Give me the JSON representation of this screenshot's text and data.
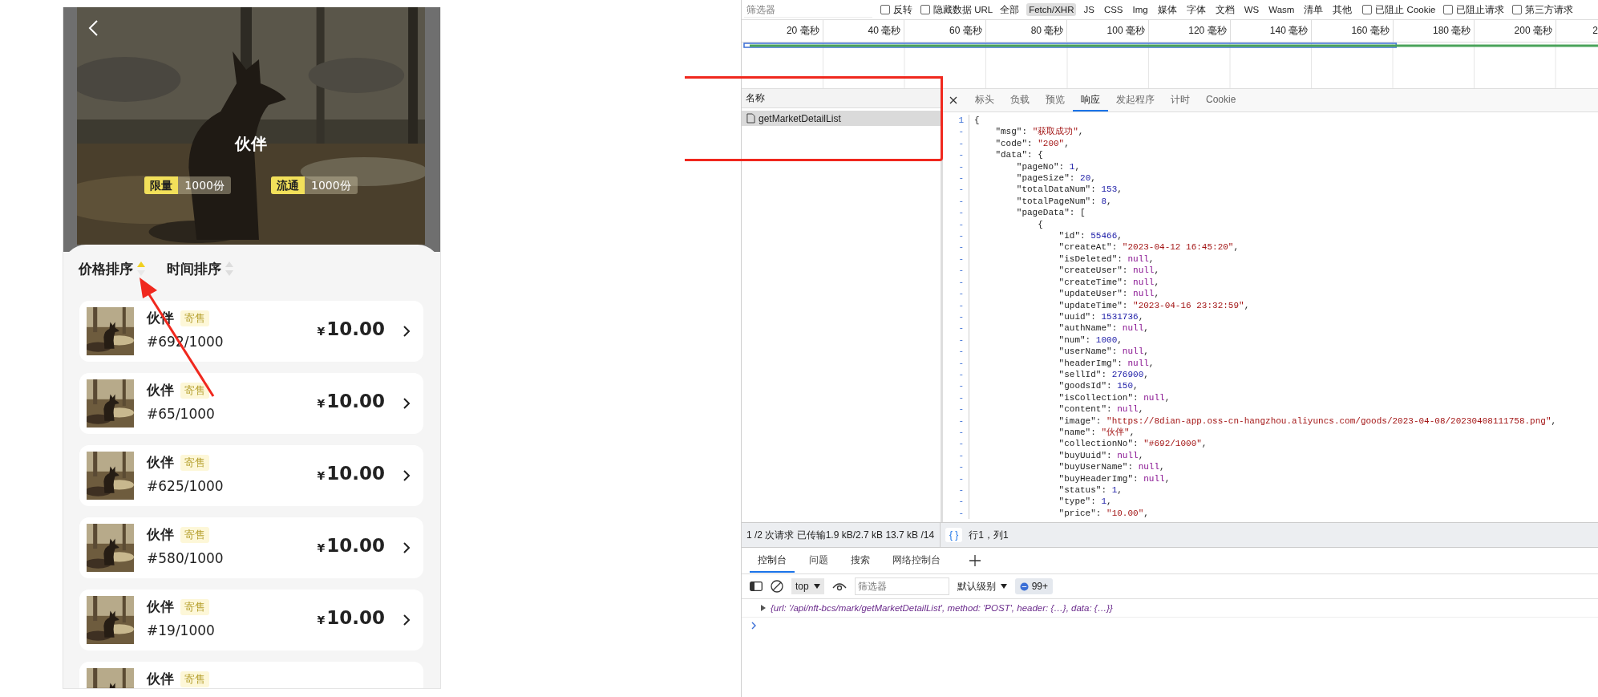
{
  "phone": {
    "title": "伙伴",
    "badges": [
      {
        "label": "限量",
        "value": "1000份"
      },
      {
        "label": "流通",
        "value": "1000份"
      }
    ],
    "sort_tabs": [
      {
        "label": "价格排序",
        "selected": true
      },
      {
        "label": "时间排序",
        "selected": false
      }
    ],
    "items": [
      {
        "name": "伙伴",
        "tag": "寄售",
        "serial": "#692/1000",
        "currency": "¥",
        "price": "10.00"
      },
      {
        "name": "伙伴",
        "tag": "寄售",
        "serial": "#65/1000",
        "currency": "¥",
        "price": "10.00"
      },
      {
        "name": "伙伴",
        "tag": "寄售",
        "serial": "#625/1000",
        "currency": "¥",
        "price": "10.00"
      },
      {
        "name": "伙伴",
        "tag": "寄售",
        "serial": "#580/1000",
        "currency": "¥",
        "price": "10.00"
      },
      {
        "name": "伙伴",
        "tag": "寄售",
        "serial": "#19/1000",
        "currency": "¥",
        "price": "10.00"
      },
      {
        "name": "伙伴",
        "tag": "寄售"
      }
    ]
  },
  "devtools": {
    "filter": {
      "placeholder": "筛选器"
    },
    "toolbar": [
      {
        "kind": "checkbox",
        "label": "反转",
        "checked": false
      },
      {
        "kind": "checkbox",
        "label": "隐藏数据 URL",
        "checked": false
      },
      {
        "kind": "type",
        "label": "全部",
        "selected": false
      },
      {
        "kind": "type",
        "label": "Fetch/XHR",
        "selected": true
      },
      {
        "kind": "type",
        "label": "JS",
        "selected": false
      },
      {
        "kind": "type",
        "label": "CSS",
        "selected": false
      },
      {
        "kind": "type",
        "label": "Img",
        "selected": false
      },
      {
        "kind": "type",
        "label": "媒体",
        "selected": false
      },
      {
        "kind": "type",
        "label": "字体",
        "selected": false
      },
      {
        "kind": "type",
        "label": "文档",
        "selected": false
      },
      {
        "kind": "type",
        "label": "WS",
        "selected": false
      },
      {
        "kind": "type",
        "label": "Wasm",
        "selected": false
      },
      {
        "kind": "type",
        "label": "清单",
        "selected": false
      },
      {
        "kind": "type",
        "label": "其他",
        "selected": false
      },
      {
        "kind": "checkbox",
        "label": "已阻止 Cookie",
        "checked": false
      },
      {
        "kind": "checkbox",
        "label": "已阻止请求",
        "checked": false
      },
      {
        "kind": "checkbox",
        "label": "第三方请求",
        "checked": false
      }
    ],
    "timeline_ticks": [
      "20 毫秒",
      "40 毫秒",
      "60 毫秒",
      "80 毫秒",
      "100 毫秒",
      "120 毫秒",
      "140 毫秒",
      "160 毫秒",
      "180 毫秒",
      "200 毫秒",
      "2"
    ],
    "requests": {
      "column": "名称",
      "rows": [
        {
          "name": "getMarketDetailList",
          "selected": true
        }
      ]
    },
    "detail_tabs": [
      {
        "label": "标头",
        "selected": false
      },
      {
        "label": "负载",
        "selected": false
      },
      {
        "label": "预览",
        "selected": false
      },
      {
        "label": "响应",
        "selected": true
      },
      {
        "label": "发起程序",
        "selected": false
      },
      {
        "label": "计时",
        "selected": false
      },
      {
        "label": "Cookie",
        "selected": false
      }
    ],
    "response_lines": [
      {
        "gutter": "1",
        "text": "{"
      },
      {
        "gutter": "-",
        "text": "    \"msg\": ",
        "value": "\"获取成功\"",
        "kind": "string",
        "end": ","
      },
      {
        "gutter": "-",
        "text": "    \"code\": ",
        "value": "\"200\"",
        "kind": "string",
        "end": ","
      },
      {
        "gutter": "-",
        "text": "    \"data\": {"
      },
      {
        "gutter": "-",
        "text": "        \"pageNo\": ",
        "value": "1",
        "kind": "number",
        "end": ","
      },
      {
        "gutter": "-",
        "text": "        \"pageSize\": ",
        "value": "20",
        "kind": "number",
        "end": ","
      },
      {
        "gutter": "-",
        "text": "        \"totalDataNum\": ",
        "value": "153",
        "kind": "number",
        "end": ","
      },
      {
        "gutter": "-",
        "text": "        \"totalPageNum\": ",
        "value": "8",
        "kind": "number",
        "end": ","
      },
      {
        "gutter": "-",
        "text": "        \"pageData\": ["
      },
      {
        "gutter": "-",
        "text": "            {"
      },
      {
        "gutter": "-",
        "text": "                \"id\": ",
        "value": "55466",
        "kind": "number",
        "end": ","
      },
      {
        "gutter": "-",
        "text": "                \"createAt\": ",
        "value": "\"2023-04-12 16:45:20\"",
        "kind": "string",
        "end": ","
      },
      {
        "gutter": "-",
        "text": "                \"isDeleted\": ",
        "value": "null",
        "kind": "null",
        "end": ","
      },
      {
        "gutter": "-",
        "text": "                \"createUser\": ",
        "value": "null",
        "kind": "null",
        "end": ","
      },
      {
        "gutter": "-",
        "text": "                \"createTime\": ",
        "value": "null",
        "kind": "null",
        "end": ","
      },
      {
        "gutter": "-",
        "text": "                \"updateUser\": ",
        "value": "null",
        "kind": "null",
        "end": ","
      },
      {
        "gutter": "-",
        "text": "                \"updateTime\": ",
        "value": "\"2023-04-16 23:32:59\"",
        "kind": "string",
        "end": ","
      },
      {
        "gutter": "-",
        "text": "                \"uuid\": ",
        "value": "1531736",
        "kind": "number",
        "end": ","
      },
      {
        "gutter": "-",
        "text": "                \"authName\": ",
        "value": "null",
        "kind": "null",
        "end": ","
      },
      {
        "gutter": "-",
        "text": "                \"num\": ",
        "value": "1000",
        "kind": "number",
        "end": ","
      },
      {
        "gutter": "-",
        "text": "                \"userName\": ",
        "value": "null",
        "kind": "null",
        "end": ","
      },
      {
        "gutter": "-",
        "text": "                \"headerImg\": ",
        "value": "null",
        "kind": "null",
        "end": ","
      },
      {
        "gutter": "-",
        "text": "                \"sellId\": ",
        "value": "276900",
        "kind": "number",
        "end": ","
      },
      {
        "gutter": "-",
        "text": "                \"goodsId\": ",
        "value": "150",
        "kind": "number",
        "end": ","
      },
      {
        "gutter": "-",
        "text": "                \"isCollection\": ",
        "value": "null",
        "kind": "null",
        "end": ","
      },
      {
        "gutter": "-",
        "text": "                \"content\": ",
        "value": "null",
        "kind": "null",
        "end": ","
      },
      {
        "gutter": "-",
        "text": "                \"image\": ",
        "value": "\"https://8dian-app.oss-cn-hangzhou.aliyuncs.com/goods/2023-04-08/20230408111758.png\"",
        "kind": "string",
        "end": ","
      },
      {
        "gutter": "-",
        "text": "                \"name\": ",
        "value": "\"伙伴\"",
        "kind": "string",
        "end": ","
      },
      {
        "gutter": "-",
        "text": "                \"collectionNo\": ",
        "value": "\"#692/1000\"",
        "kind": "string",
        "end": ","
      },
      {
        "gutter": "-",
        "text": "                \"buyUuid\": ",
        "value": "null",
        "kind": "null",
        "end": ","
      },
      {
        "gutter": "-",
        "text": "                \"buyUserName\": ",
        "value": "null",
        "kind": "null",
        "end": ","
      },
      {
        "gutter": "-",
        "text": "                \"buyHeaderImg\": ",
        "value": "null",
        "kind": "null",
        "end": ","
      },
      {
        "gutter": "-",
        "text": "                \"status\": ",
        "value": "1",
        "kind": "number",
        "end": ","
      },
      {
        "gutter": "-",
        "text": "                \"type\": ",
        "value": "1",
        "kind": "number",
        "end": ","
      },
      {
        "gutter": "-",
        "text": "                \"price\": ",
        "value": "\"10.00\"",
        "kind": "string",
        "end": ","
      }
    ],
    "status": {
      "summary": "1 /2 次请求  已传输1.9 kB/2.7 kB  13.7 kB /14",
      "format_button": "{ }",
      "position": "行1，列1"
    },
    "console": {
      "tabs": [
        {
          "label": "控制台",
          "selected": true
        },
        {
          "label": "问题",
          "selected": false
        },
        {
          "label": "搜索",
          "selected": false
        },
        {
          "label": "网络控制台",
          "selected": false
        }
      ],
      "context": "top",
      "filter_placeholder": "筛选器",
      "level": "默认级别",
      "message_count": "99+",
      "log": "{url: '/api/nft-bcs/mark/getMarketDetailList', method: 'POST', header: {…}, data: {…}}"
    }
  }
}
